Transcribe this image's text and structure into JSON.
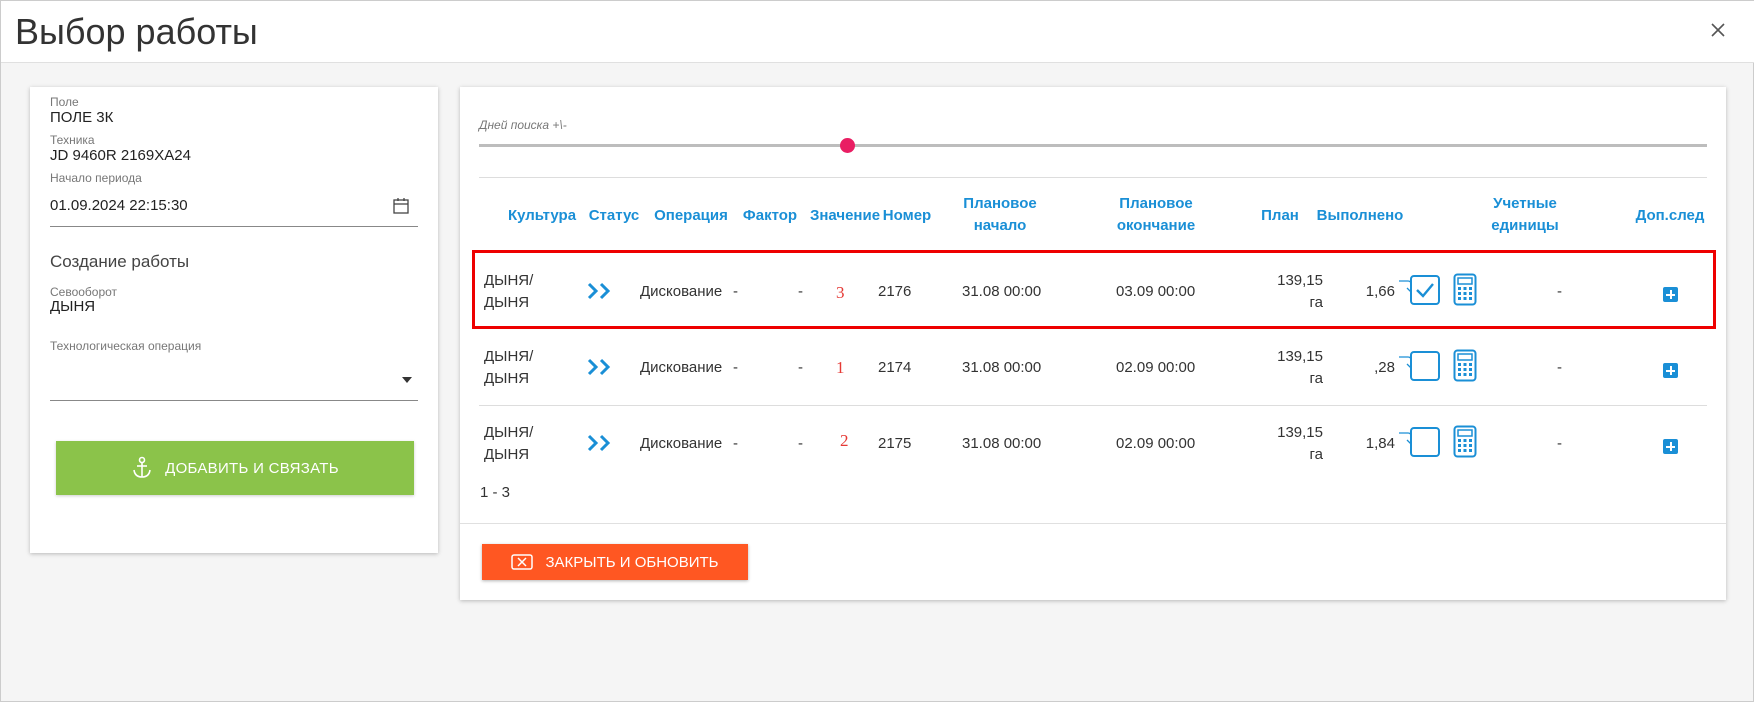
{
  "modal": {
    "title": "Выбор работы"
  },
  "left": {
    "field_label": "Поле",
    "field_value": "ПОЛЕ 3К",
    "tech_label": "Техника",
    "tech_value": "JD 9460R 2169ХА24",
    "period_label": "Начало периода",
    "period_value": "01.09.2024 22:15:30",
    "section_title": "Создание работы",
    "rotation_label": "Севооборот",
    "rotation_value": "ДЫНЯ",
    "operation_label": "Технологическая операция",
    "operation_value": "",
    "add_button": "ДОБАВИТЬ И СВЯЗАТЬ"
  },
  "right": {
    "slider_label": "Дней поиска +\\-",
    "slider_value": 0.3,
    "headers": {
      "culture": "Культура",
      "status": "Статус",
      "operation": "Операция",
      "factor": "Фактор",
      "value": "Значение",
      "number": "Номер",
      "plan_start_1": "Плановое",
      "plan_start_2": "начало",
      "plan_end_1": "Плановое",
      "plan_end_2": "окончание",
      "plan": "План",
      "done": "Выполнено",
      "units_1": "Учетные",
      "units_2": "единицы",
      "extra": "Доп.след"
    },
    "rows": [
      {
        "culture_1": "ДЫНЯ/",
        "culture_2": "ДЫНЯ",
        "operation": "Дискование",
        "factor": "-",
        "value": "-",
        "annotation": "3",
        "number": "2176",
        "plan_start": "31.08 00:00",
        "plan_end": "03.09 00:00",
        "plan_1": "139,15",
        "plan_2": "га",
        "done": "1,66",
        "checked": true,
        "units": "-"
      },
      {
        "culture_1": "ДЫНЯ/",
        "culture_2": "ДЫНЯ",
        "operation": "Дискование",
        "factor": "-",
        "value": "-",
        "annotation": "1",
        "number": "2174",
        "plan_start": "31.08 00:00",
        "plan_end": "02.09 00:00",
        "plan_1": "139,15",
        "plan_2": "га",
        "done": ",28",
        "checked": false,
        "units": "-"
      },
      {
        "culture_1": "ДЫНЯ/",
        "culture_2": "ДЫНЯ",
        "operation": "Дискование",
        "factor": "-",
        "value": "-",
        "annotation": "2",
        "number": "2175",
        "plan_start": "31.08 00:00",
        "plan_end": "02.09 00:00",
        "plan_1": "139,15",
        "plan_2": "га",
        "done": "1,84",
        "checked": false,
        "units": "-"
      }
    ],
    "pager": "1 - 3",
    "close_button": "ЗАКРЫТЬ И ОБНОВИТЬ"
  },
  "colors": {
    "accent": "#1a8fd6",
    "green": "#8bc34a",
    "orange": "#ff5722",
    "pink": "#e91e63",
    "highlight": "#ee0000"
  },
  "icons": [
    "close-icon",
    "calendar-icon",
    "anchor-icon",
    "status-forward-icon",
    "redirect-arrow-icon",
    "checkmark-icon",
    "calculator-icon",
    "plus-icon",
    "close-box-icon"
  ]
}
